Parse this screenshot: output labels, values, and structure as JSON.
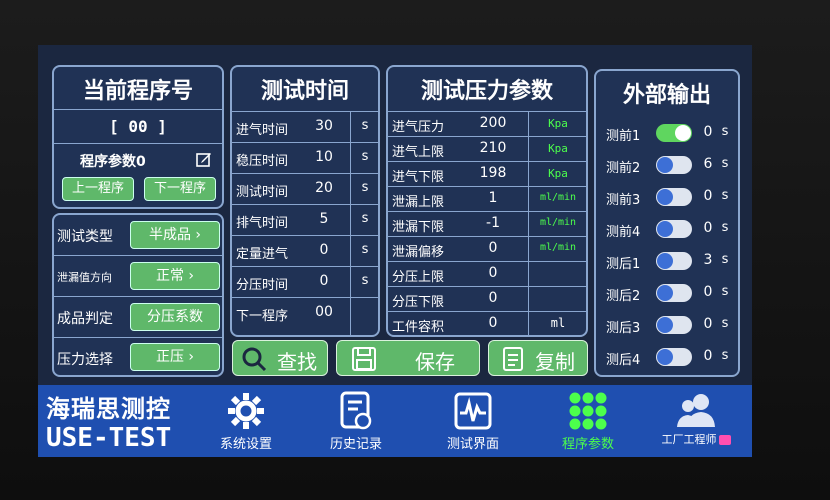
{
  "program": {
    "title": "当前程序号",
    "number": "[ 00 ]",
    "params_label": "程序参数0",
    "prev_label": "上一程序",
    "next_label": "下一程序",
    "options": [
      {
        "label": "测试类型",
        "value": "半成品"
      },
      {
        "label": "泄漏值方向",
        "value": "正常"
      },
      {
        "label": "成品判定",
        "value": "分压系数"
      },
      {
        "label": "压力选择",
        "value": "正压"
      }
    ]
  },
  "test_time": {
    "title": "测试时间",
    "rows": [
      {
        "label": "进气时间",
        "value": "30",
        "unit": "s"
      },
      {
        "label": "稳压时间",
        "value": "10",
        "unit": "s"
      },
      {
        "label": "测试时间",
        "value": "20",
        "unit": "s"
      },
      {
        "label": "排气时间",
        "value": "5",
        "unit": "s"
      },
      {
        "label": "定量进气",
        "value": "0",
        "unit": "s"
      },
      {
        "label": "分压时间",
        "value": "0",
        "unit": "s"
      },
      {
        "label": "下一程序",
        "value": "00",
        "unit": ""
      }
    ]
  },
  "pressure": {
    "title": "测试压力参数",
    "rows": [
      {
        "label": "进气压力",
        "value": "200",
        "unit": "Kpa"
      },
      {
        "label": "进气上限",
        "value": "210",
        "unit": "Kpa"
      },
      {
        "label": "进气下限",
        "value": "198",
        "unit": "Kpa"
      },
      {
        "label": "泄漏上限",
        "value": "1",
        "unit": "ml/min"
      },
      {
        "label": "泄漏下限",
        "value": "-1",
        "unit": "ml/min"
      },
      {
        "label": "泄漏偏移",
        "value": "0",
        "unit": "ml/min"
      },
      {
        "label": "分压上限",
        "value": "0",
        "unit": ""
      },
      {
        "label": "分压下限",
        "value": "0",
        "unit": ""
      },
      {
        "label": "工件容积",
        "value": "0",
        "unit": "ml"
      }
    ]
  },
  "output": {
    "title": "外部输出",
    "rows": [
      {
        "label": "测前1",
        "on": true,
        "value": "0",
        "unit": "s"
      },
      {
        "label": "测前2",
        "on": false,
        "value": "6",
        "unit": "s"
      },
      {
        "label": "测前3",
        "on": false,
        "value": "0",
        "unit": "s"
      },
      {
        "label": "测前4",
        "on": false,
        "value": "0",
        "unit": "s"
      },
      {
        "label": "测后1",
        "on": false,
        "value": "3",
        "unit": "s"
      },
      {
        "label": "测后2",
        "on": false,
        "value": "0",
        "unit": "s"
      },
      {
        "label": "测后3",
        "on": false,
        "value": "0",
        "unit": "s"
      },
      {
        "label": "测后4",
        "on": false,
        "value": "0",
        "unit": "s"
      }
    ]
  },
  "actions": {
    "find": "查找",
    "save": "保存",
    "copy": "复制"
  },
  "brand": {
    "line1": "海瑞思测控",
    "line2": "USE-TEST"
  },
  "nav": {
    "settings": "系统设置",
    "history": "历史记录",
    "test_ui": "测试界面",
    "program_params": "程序参数",
    "engineer": "工厂工程师"
  },
  "colors": {
    "green": "#5fb86a",
    "nav_blue": "#1f4fb0",
    "panel": "#203255",
    "unit_green": "#4cff4c"
  }
}
